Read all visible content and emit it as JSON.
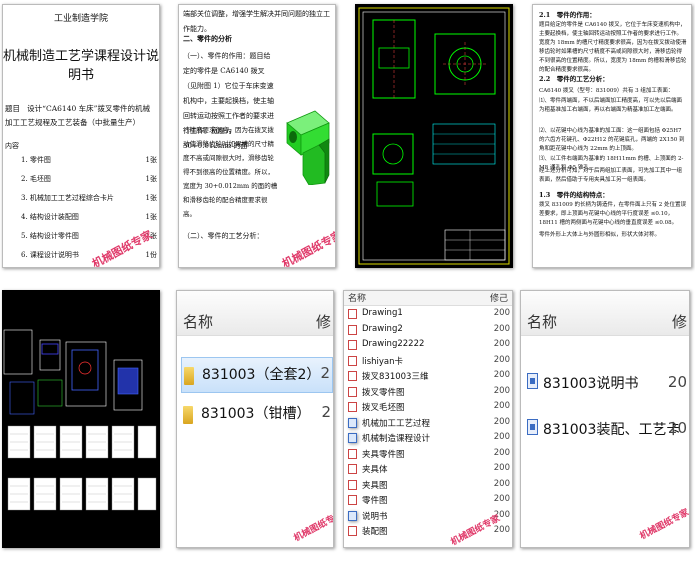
{
  "panel1": {
    "school": "工业制造学院",
    "title": "机械制造工艺学课程设计说明书",
    "topic_label": "题目",
    "topic_text": "设计“CA6140 车床”拨叉零件的机械加工工艺规程及工艺装备（中批量生产）",
    "toc_label": "内容",
    "toc": [
      {
        "num": "1.",
        "text": "零件图",
        "page": "1张"
      },
      {
        "num": "2.",
        "text": "毛坯图",
        "page": "1张"
      },
      {
        "num": "3.",
        "text": "机械加工工艺过程综合卡片",
        "page": "1张"
      },
      {
        "num": "4.",
        "text": "结构设计装配图",
        "page": "1张"
      },
      {
        "num": "5.",
        "text": "结构设计零件图",
        "page": "1张"
      },
      {
        "num": "6.",
        "text": "课程设计说明书",
        "page": "1份"
      }
    ],
    "watermark": "机械图纸专家"
  },
  "panel2": {
    "line0": "端部关位调整，增强学生解决并同问题的独立工作能力。",
    "heading": "二、零件的分析",
    "sub1": "（一）、零件的作用：题目给定的零件是 CA6140 拨叉（见附图 1）它位于车床变速机构中，主要起换档，使主轴回转运动按照工作者的要求进行工作。宽度为 30+0.012mm 的面",
    "sub1b": "寸精度要求很高，因为在拨叉拨动使滑移齿轮时如果槽的尺寸精度不高或间隙很大时，滑移齿轮得不到很高的位置精度。所以，宽度为 30+0.012mm 的面的槽和滑移齿轮的配合精度要求很高。",
    "sub2": "（二）、零件的工艺分析：",
    "watermark": "机械图纸专家"
  },
  "panel4": {
    "h1": "2.1　零件的作用：",
    "p1": "题目给定的零件是 CA6140 拨叉，它位于车床变速机构中，主要起换档，使主轴回转运动按照工作者的要求进行工作。宽度为 18mm 的槽尺寸精度要求很高，因为在拨叉拨动使滑移齿轮时如果槽的尺寸精度不高或间隙很大时，滑移齿轮得不到很高的位置精度。所以，宽度为 18mm 的槽和滑移齿轮的配合精度要求很高。",
    "h2": "2.2　零件的工艺分析：",
    "p2": "CA6140 拨叉（型号：831009）共有 3 组加工表面：",
    "p3": "⑴、零件两端面，不以后端面加工精度高，可以先以后端面为粗基准加工右端面，再以右端面为精基准加工左端面。",
    "p4": "⑵、以花键中心线为基准的加工面：这一组面包括 Φ25H7 的六齿方花键孔、Φ22H12 的花键底孔，两端的 2X150 到角和距花键中心线为 22mm 的上顶面。",
    "p5": "⑶、以工件右端面为基准的 18H11mm 的槽、上顶面的 2-M8 通孔和 Φ5 锥孔。",
    "p6": "经上述分析可知，对于后两组加工表面，可先加工其中一组表面，然后借助于专用夹具加工另一组表面。",
    "h3": "1.3　零件的结构特点：",
    "p7": "拨叉 831009 的长柄为铸造件，在零件面上只有 2 处位置误差要求，即上顶面与花键中心线的平行度误差 ≤0.10，18H11 槽的两侧面与花键中心线的垂直度误差 ≤0.08。",
    "p8": "零件外形上大体上与外圆形相似，形状大体对称。"
  },
  "panel6": {
    "col_name": "名称",
    "col_date": "修",
    "rows": [
      {
        "name": "831003（全套2）",
        "date": "2"
      },
      {
        "name": "831003（钳槽）",
        "date": "2"
      }
    ],
    "watermark": "机械图纸专家"
  },
  "panel7": {
    "col_name": "名称",
    "col_date": "修己",
    "rows": [
      {
        "name": "Drawing1",
        "date": "200",
        "icon": "dwg"
      },
      {
        "name": "Drawing2",
        "date": "200",
        "icon": "dwg"
      },
      {
        "name": "Drawing22222",
        "date": "200",
        "icon": "dwg"
      },
      {
        "name": "lishiyan卡",
        "date": "200",
        "icon": "dwg"
      },
      {
        "name": "拨叉831003三维",
        "date": "200",
        "icon": "dwg"
      },
      {
        "name": "拨叉零件图",
        "date": "200",
        "icon": "dwg"
      },
      {
        "name": "拨叉毛坯图",
        "date": "200",
        "icon": "dwg"
      },
      {
        "name": "机械加工工艺过程",
        "date": "200",
        "icon": "doc"
      },
      {
        "name": "机械制造课程设计",
        "date": "200",
        "icon": "doc"
      },
      {
        "name": "夹具零件图",
        "date": "200",
        "icon": "dwg"
      },
      {
        "name": "夹具体",
        "date": "200",
        "icon": "dwg"
      },
      {
        "name": "夹具图",
        "date": "200",
        "icon": "dwg"
      },
      {
        "name": "零件图",
        "date": "200",
        "icon": "dwg"
      },
      {
        "name": "说明书",
        "date": "200",
        "icon": "doc"
      },
      {
        "name": "装配图",
        "date": "200",
        "icon": "dwg"
      }
    ],
    "watermark": "机械图纸专家"
  },
  "panel8": {
    "col_name": "名称",
    "col_date": "修",
    "rows": [
      {
        "name": "831003说明书",
        "date": "20"
      },
      {
        "name": "831003装配、工艺卡",
        "date": "20"
      }
    ],
    "watermark": "机械图纸专家"
  },
  "colors": {
    "watermark": "#e03a6a",
    "cad_bg": "#000000",
    "part_green": "#22dd22",
    "select": "#c9e1fa"
  }
}
